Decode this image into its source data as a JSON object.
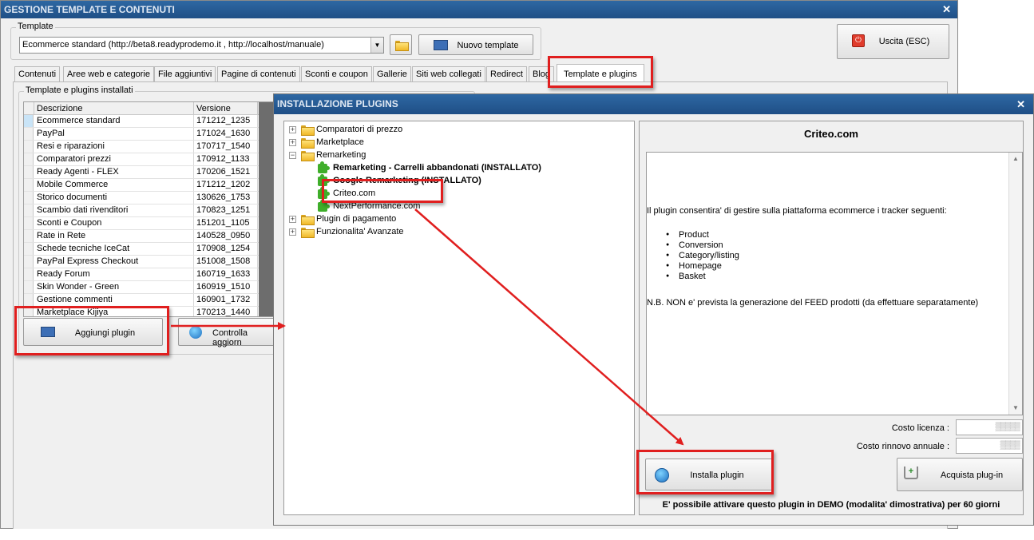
{
  "main_window": {
    "title": "GESTIONE TEMPLATE E CONTENUTI",
    "close_glyph": "✕",
    "template_label": "Template",
    "template_combo_value": "Ecommerce standard (http://beta8.readyprodemo.it , http://localhost/manuale)",
    "new_template_button": "Nuovo template",
    "exit_button": "Uscita (ESC)"
  },
  "tabs": [
    {
      "label": "Contenuti"
    },
    {
      "label": "Aree web e categorie"
    },
    {
      "label": "File aggiuntivi"
    },
    {
      "label": "Pagine di contenuti"
    },
    {
      "label": "Sconti e coupon"
    },
    {
      "label": "Gallerie"
    },
    {
      "label": "Siti web collegati"
    },
    {
      "label": "Redirect"
    },
    {
      "label": "Blog"
    },
    {
      "label": "Template e plugins",
      "active": true
    }
  ],
  "installed": {
    "group_label": "Template e plugins installati",
    "col_description": "Descrizione",
    "col_version": "Versione",
    "rows": [
      {
        "name": "Ecommerce standard",
        "version": "171212_1235"
      },
      {
        "name": "PayPal",
        "version": "171024_1630"
      },
      {
        "name": "Resi e riparazioni",
        "version": "170717_1540"
      },
      {
        "name": "Comparatori prezzi",
        "version": "170912_1133"
      },
      {
        "name": "Ready Agenti - FLEX",
        "version": "170206_1521"
      },
      {
        "name": "Mobile Commerce",
        "version": "171212_1202"
      },
      {
        "name": "Storico documenti",
        "version": "130626_1753"
      },
      {
        "name": "Scambio dati rivenditori",
        "version": "170823_1251"
      },
      {
        "name": "Sconti e Coupon",
        "version": "151201_1105"
      },
      {
        "name": "Rate in Rete",
        "version": "140528_0950"
      },
      {
        "name": "Schede tecniche IceCat",
        "version": "170908_1254"
      },
      {
        "name": "PayPal Express Checkout",
        "version": "151008_1508"
      },
      {
        "name": "Ready Forum",
        "version": "160719_1633"
      },
      {
        "name": "Skin Wonder - Green",
        "version": "160919_1510"
      },
      {
        "name": "Gestione commenti",
        "version": "160901_1732"
      },
      {
        "name": "Marketplace Kijiya",
        "version": "170213_1440"
      }
    ],
    "add_plugin_button": "Aggiungi plugin",
    "check_updates_button": "Controlla aggiorn"
  },
  "dialog": {
    "title": "INSTALLAZIONE PLUGINS",
    "close_glyph": "✕",
    "tree": [
      {
        "label": "Comparatori di prezzo",
        "level": 0,
        "type": "folder",
        "expander": "+"
      },
      {
        "label": "Marketplace",
        "level": 0,
        "type": "folder",
        "expander": "+"
      },
      {
        "label": "Remarketing",
        "level": 0,
        "type": "folder",
        "expander": "−"
      },
      {
        "label": "Remarketing - Carrelli abbandonati (INSTALLATO)",
        "level": 1,
        "type": "plugin",
        "bold": true
      },
      {
        "label": "Google Remarketing (INSTALLATO)",
        "level": 1,
        "type": "plugin",
        "bold": true
      },
      {
        "label": "Criteo.com",
        "level": 1,
        "type": "plugin",
        "bold": false
      },
      {
        "label": "NextPerformance.com",
        "level": 1,
        "type": "plugin",
        "bold": false
      },
      {
        "label": "Plugin di pagamento",
        "level": 0,
        "type": "folder",
        "expander": "+"
      },
      {
        "label": "Funzionalita' Avanzate",
        "level": 0,
        "type": "folder",
        "expander": "+"
      }
    ],
    "plugin_title": "Criteo.com",
    "description_intro": "Il plugin consentira' di gestire sulla piattaforma ecommerce i tracker seguenti:",
    "description_bullets": [
      "Product",
      "Conversion",
      "Category/listing",
      "Homepage",
      "Basket"
    ],
    "description_note": "N.B. NON e' prevista la generazione del FEED prodotti (da effettuare separatamente)",
    "license_cost_label": "Costo licenza :",
    "license_cost_value": "▒▒▒▒▒",
    "renewal_cost_label": "Costo rinnovo annuale :",
    "renewal_cost_value": "▒▒▒▒",
    "install_button": "Installa plugin",
    "buy_button": "Acquista plug-in",
    "demo_note": "E' possibile attivare questo plugin in DEMO (modalita' dimostrativa) per 60 giorni"
  },
  "colors": {
    "highlight": "#e01f1f",
    "titlebar": "#2e68a3",
    "selected_row": "#c9e4f7"
  }
}
